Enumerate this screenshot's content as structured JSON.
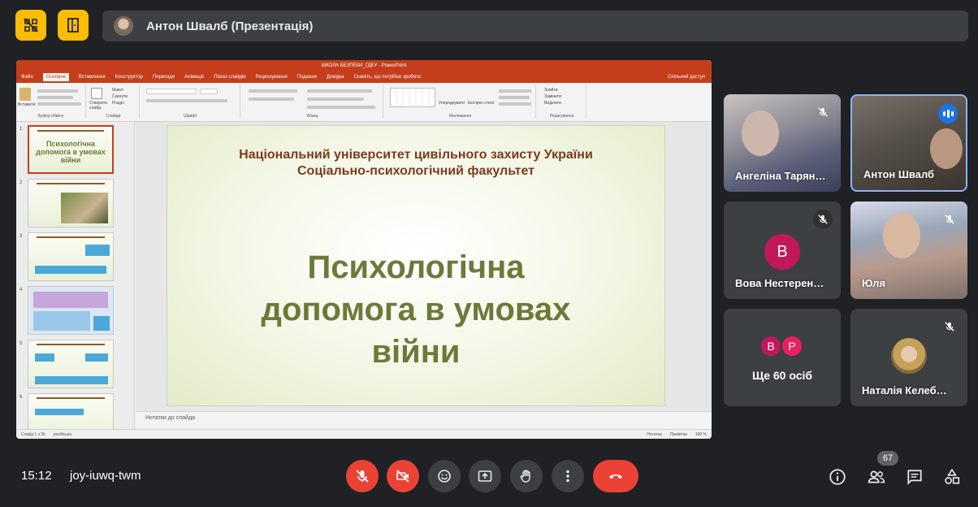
{
  "topbar": {
    "presenter_name": "Антон Швалб (Презентація)",
    "accent": "#fbbc04"
  },
  "ppt": {
    "window_title": "ШКОЛА БЕЗПЕКИ_ГДЕУ - PowerPoint",
    "tabs": [
      "Файл",
      "Основне",
      "Вставлення",
      "Конструктор",
      "Переходи",
      "Анімація",
      "Показ слайдів",
      "Рецензування",
      "Подання",
      "Довідка",
      "Скажіть, що потрібно зробити"
    ],
    "share": "Спільний доступ",
    "ribbon_groups": [
      "Буфер обміну",
      "Слайди",
      "Шрифт",
      "Абзац",
      "Малювання",
      "Редагування"
    ],
    "ribbon_items": {
      "paste": "Вставити",
      "new_slide": "Створити слайд",
      "layout": "Макет",
      "reset": "Скинути",
      "section": "Розділ",
      "arrange": "Упорядкувати",
      "quick_styles": "Експрес-стилі",
      "find": "Знайти",
      "replace": "Замінити",
      "select": "Виділити"
    },
    "slide": {
      "university_line1": "Національний університет цивільного захисту України",
      "university_line2": "Соціально-психологічний факультет",
      "title_line1": "Психологічна",
      "title_line2": "допомога в умовах",
      "title_line3": "війни"
    },
    "thumb1_text": "Психологічна допомога в умовах війни",
    "thumb_numbers": [
      "1",
      "2",
      "3",
      "4",
      "5",
      "6"
    ],
    "notes": "Нотатки до слайда",
    "status_slide": "Слайд 1 з 36",
    "status_lang": "російська",
    "status_notes": "Нотатки",
    "status_comments": "Примітки",
    "zoom": "100 %"
  },
  "participants": [
    {
      "name": "Ангеліна Тарян…",
      "muted": true
    },
    {
      "name": "Антон Швалб",
      "muted": false,
      "speaking": true
    },
    {
      "name": "Вова Нестерен…",
      "initial": "В",
      "muted": true
    },
    {
      "name": "Юля",
      "muted": true
    },
    {
      "name": "Ще 60 осіб",
      "avatars": [
        "В",
        "Р"
      ]
    },
    {
      "name": "Наталія Келеб…",
      "muted": true
    }
  ],
  "bottombar": {
    "time": "15:12",
    "meeting_code": "joy-iuwq-twm",
    "participant_count": "67"
  }
}
